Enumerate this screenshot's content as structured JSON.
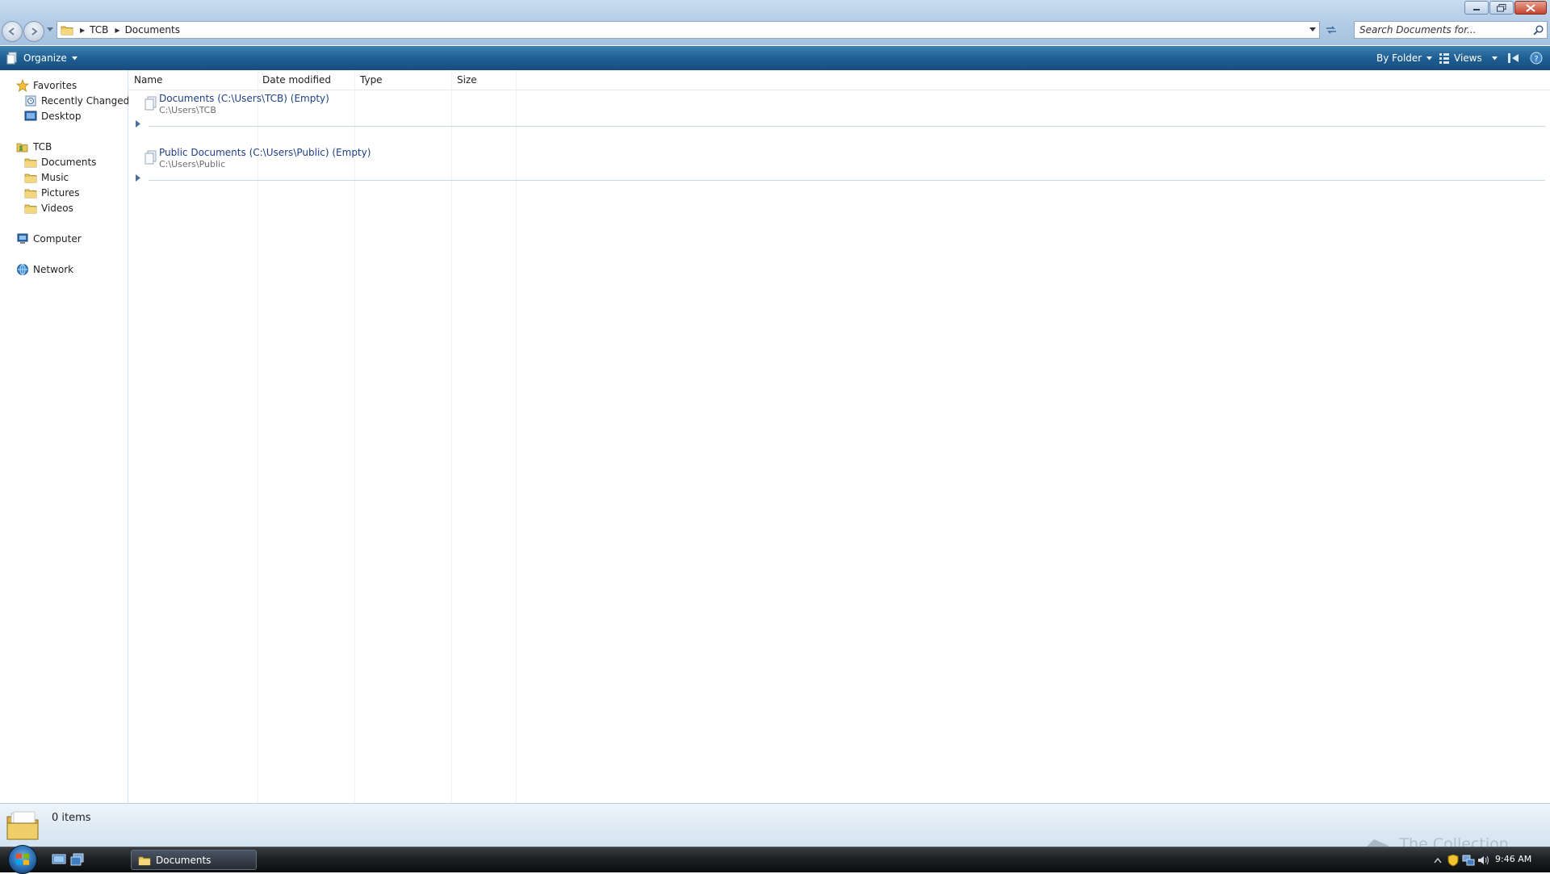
{
  "address": {
    "breadcrumbs": [
      "TCB",
      "Documents"
    ]
  },
  "search": {
    "placeholder": "Search Documents for..."
  },
  "commandbar": {
    "organize": "Organize",
    "by_folder": "By Folder",
    "views": "Views"
  },
  "navpane": {
    "favorites": {
      "label": "Favorites",
      "items": [
        "Recently Changed",
        "Desktop"
      ]
    },
    "user": {
      "label": "TCB",
      "items": [
        "Documents",
        "Music",
        "Pictures",
        "Videos"
      ]
    },
    "computer": "Computer",
    "network": "Network"
  },
  "columns": [
    "Name",
    "Date modified",
    "Type",
    "Size"
  ],
  "groups": [
    {
      "title": "Documents (C:\\Users\\TCB) (Empty)",
      "path": "C:\\Users\\TCB"
    },
    {
      "title": "Public Documents (C:\\Users\\Public) (Empty)",
      "path": "C:\\Users\\Public"
    }
  ],
  "details": {
    "count": "0 items"
  },
  "taskbar": {
    "task": "Documents",
    "clock": "9:46 AM"
  },
  "watermark": "The Collection Book"
}
